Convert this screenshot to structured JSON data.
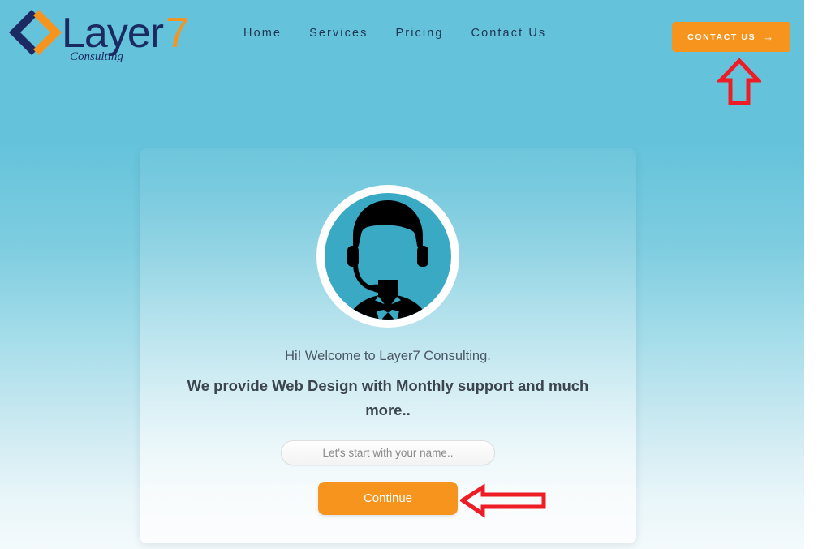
{
  "brand": {
    "logo_text": "Layer7",
    "logo_number": "7",
    "logo_tagline": "Consulting",
    "logo_icon": "diamond-chevrons-icon",
    "navy": "#1F3552",
    "orange": "#F7941D",
    "teal": "#64C3DB"
  },
  "header": {
    "nav": [
      {
        "label": "Home",
        "name": "nav-link-home"
      },
      {
        "label": "Services",
        "name": "nav-link-services"
      },
      {
        "label": "Pricing",
        "name": "nav-link-pricing"
      },
      {
        "label": "Contact Us",
        "name": "nav-link-contact-us"
      }
    ],
    "cta": {
      "label": "CONTACT US",
      "arrow": "→",
      "icon": "arrow-right-icon"
    }
  },
  "chat_widget": {
    "avatar_icon": "support-agent-headset-avatar",
    "greeting": "Hi! Welcome to Layer7 Consulting.",
    "tagline": "We provide Web Design with Monthly support and much more..",
    "input": {
      "placeholder": "Let's start with your name..",
      "value": ""
    },
    "continue_label": "Continue"
  },
  "annotations": {
    "color": "#EE1C25",
    "arrow_up": {
      "name": "annotation-arrow-up",
      "points_to": "CONTACT US"
    },
    "arrow_left": {
      "name": "annotation-arrow-left",
      "points_to": "Continue"
    }
  }
}
